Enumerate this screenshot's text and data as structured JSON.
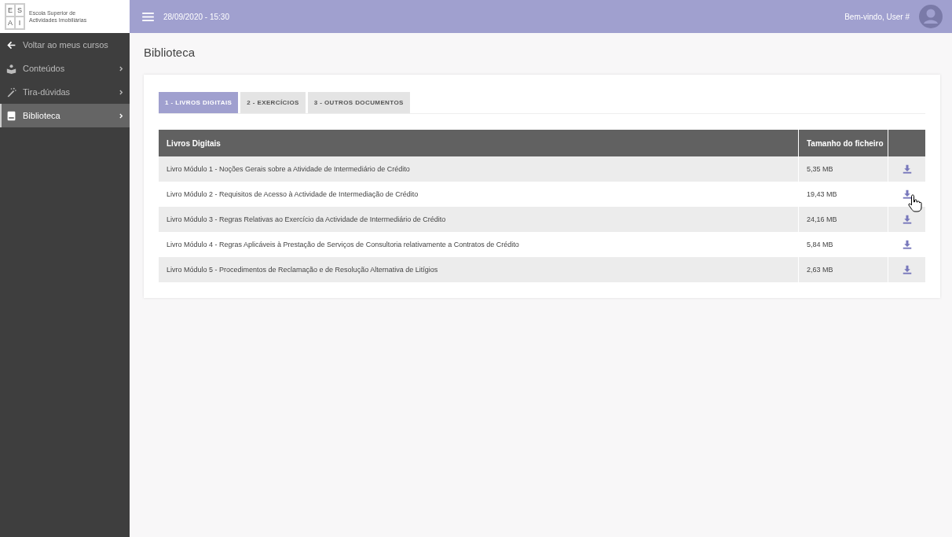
{
  "logo": {
    "letters": [
      "E",
      "S",
      "A",
      "I"
    ],
    "name": "Escola Superior de Actividades Imobiliárias"
  },
  "header": {
    "datetime": "28/09/2020 - 15:30",
    "welcome": "Bem-vindo, User #"
  },
  "sidebar": {
    "items": [
      {
        "kind": "back",
        "label": "Voltar ao meus cursos",
        "selected": false
      },
      {
        "kind": "contents",
        "label": "Conteúdos",
        "selected": false
      },
      {
        "kind": "help",
        "label": "Tira-dúvidas",
        "selected": false
      },
      {
        "kind": "library",
        "label": "Biblioteca",
        "selected": true
      }
    ]
  },
  "page_title": "Biblioteca",
  "tabs": [
    {
      "label": "1 - LIVROS DIGITAIS",
      "selected": true
    },
    {
      "label": "2 - EXERCÍCIOS",
      "selected": false
    },
    {
      "label": "3 - OUTROS DOCUMENTOS",
      "selected": false
    }
  ],
  "table": {
    "columns": [
      "Livros Digitais",
      "Tamanho do ficheiro"
    ],
    "rows": [
      {
        "title": "Livro Módulo 1 - Noções Gerais sobre a Atividade de Intermediário de Crédito",
        "size": "5,35 MB"
      },
      {
        "title": "Livro Módulo 2 - Requisitos de Acesso à Actividade de Intermediação de Crédito",
        "size": "19,43 MB"
      },
      {
        "title": "Livro Módulo 3 - Regras Relativas ao Exercício da Actividade de Intermediário de Crédito",
        "size": "24,16 MB"
      },
      {
        "title": "Livro Módulo 4 - Regras Aplicáveis à Prestação de Serviços de Consultoria relativamente a Contratos de Crédito",
        "size": "5,84 MB"
      },
      {
        "title": "Livro Módulo 5 - Procedimentos de Reclamação e de Resolução Alternativa de Litígios",
        "size": "2,63 MB"
      }
    ]
  }
}
